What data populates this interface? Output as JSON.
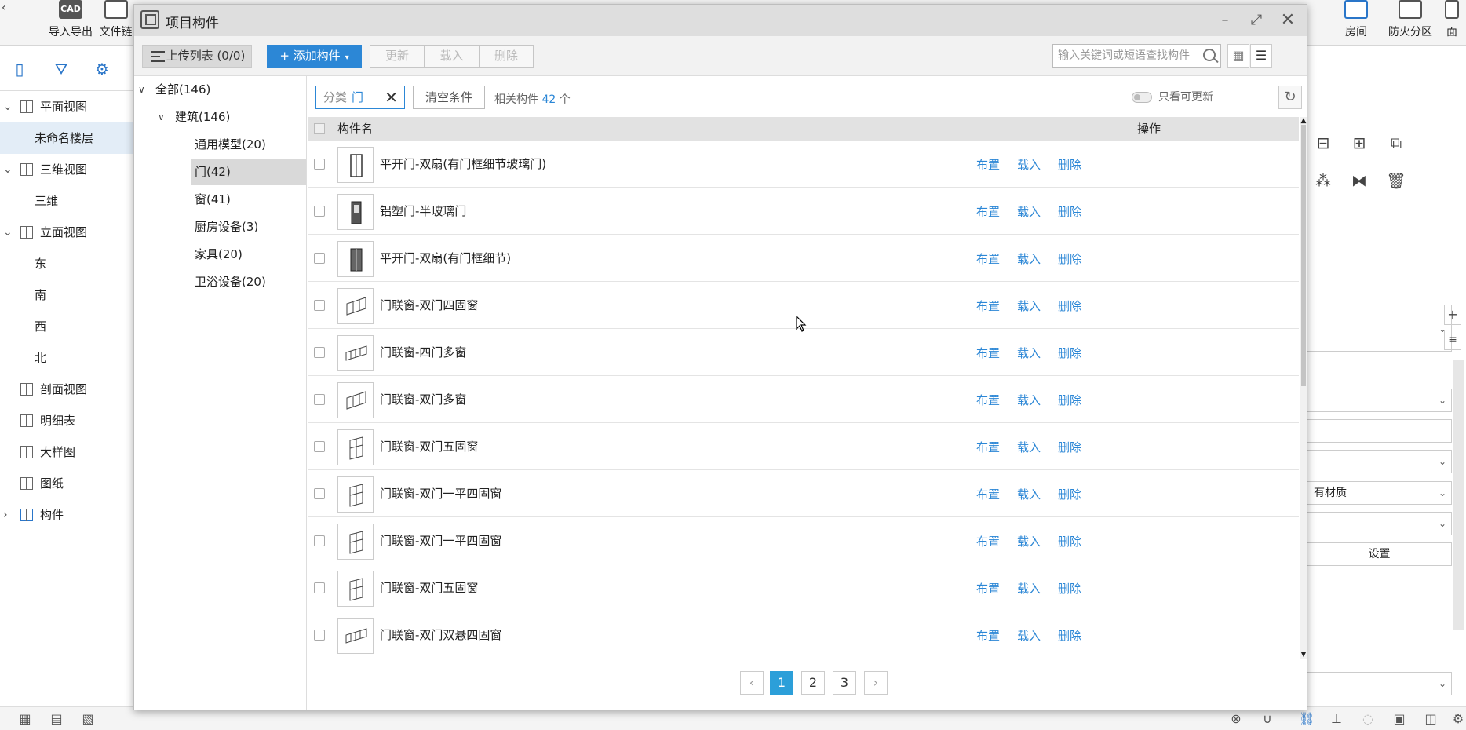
{
  "app_toolbar": {
    "items": [
      {
        "label": "导入导出",
        "icon": "cad-icon",
        "icon_text": "CAD"
      },
      {
        "label": "文件链",
        "icon": "file-link-icon",
        "icon_text": ""
      },
      {
        "label": "房间",
        "icon": "room-icon",
        "icon_text": ""
      },
      {
        "label": "防火分区",
        "icon": "fire-zone-icon",
        "icon_text": ""
      },
      {
        "label": "面",
        "icon": "area-icon",
        "icon_text": ""
      }
    ]
  },
  "left_panel": {
    "tree": [
      {
        "label": "平面视图",
        "expanded": true,
        "level": 0
      },
      {
        "label": "未命名楼层",
        "level": 1,
        "selected": true
      },
      {
        "label": "三维视图",
        "expanded": true,
        "level": 0
      },
      {
        "label": "三维",
        "level": 1
      },
      {
        "label": "立面视图",
        "expanded": true,
        "level": 0
      },
      {
        "label": "东",
        "level": 1
      },
      {
        "label": "南",
        "level": 1
      },
      {
        "label": "西",
        "level": 1
      },
      {
        "label": "北",
        "level": 1
      },
      {
        "label": "剖面视图",
        "level": 0
      },
      {
        "label": "明细表",
        "level": 0
      },
      {
        "label": "大样图",
        "level": 0
      },
      {
        "label": "图纸",
        "level": 0
      },
      {
        "label": "构件",
        "level": 0,
        "collapsed": true
      }
    ]
  },
  "right_panel": {
    "material_field": "有材质",
    "settings_button": "设置"
  },
  "dialog": {
    "title": "项目构件",
    "toolbar": {
      "upload_label": "上传列表 (0/0)",
      "add_label": "+ 添加构件",
      "update_label": "更新",
      "load_label": "载入",
      "delete_label": "删除",
      "search_placeholder": "输入关键词或短语查找构件"
    },
    "categories": {
      "root": "全部(146)",
      "group": "建筑(146)",
      "items": [
        {
          "label": "通用模型(20)"
        },
        {
          "label": "门(42)",
          "selected": true
        },
        {
          "label": "窗(41)"
        },
        {
          "label": "厨房设备(3)"
        },
        {
          "label": "家具(20)"
        },
        {
          "label": "卫浴设备(20)"
        }
      ]
    },
    "filter": {
      "chip_key": "分类",
      "chip_value": "门",
      "clear_label": "清空条件",
      "result_prefix": "相关构件",
      "result_count": "42",
      "result_suffix": "个",
      "toggle_label": "只看可更新"
    },
    "table": {
      "col_name": "构件名",
      "col_ops": "操作",
      "action_place": "布置",
      "action_load": "载入",
      "action_delete": "删除",
      "rows": [
        {
          "name": "平开门-双扇(有门框细节玻璃门)",
          "thumb": "double-door"
        },
        {
          "name": "铝塑门-半玻璃门",
          "thumb": "single-door"
        },
        {
          "name": "平开门-双扇(有门框细节)",
          "thumb": "double-door-dark"
        },
        {
          "name": "门联窗-双门四固窗",
          "thumb": "door-window"
        },
        {
          "name": "门联窗-四门多窗",
          "thumb": "door-window-wide"
        },
        {
          "name": "门联窗-双门多窗",
          "thumb": "door-window"
        },
        {
          "name": "门联窗-双门五固窗",
          "thumb": "door-window-tall"
        },
        {
          "name": "门联窗-双门一平四固窗",
          "thumb": "door-window-tall"
        },
        {
          "name": "门联窗-双门一平四固窗",
          "thumb": "door-window-tall"
        },
        {
          "name": "门联窗-双门五固窗",
          "thumb": "door-window-tall"
        },
        {
          "name": "门联窗-双门双悬四固窗",
          "thumb": "door-window-wide"
        }
      ]
    },
    "pagination": {
      "pages": [
        "1",
        "2",
        "3"
      ],
      "current": "1"
    }
  },
  "colors": {
    "accent": "#2c87d6",
    "page_active": "#2c9fd9",
    "title_bar": "#dedede"
  }
}
